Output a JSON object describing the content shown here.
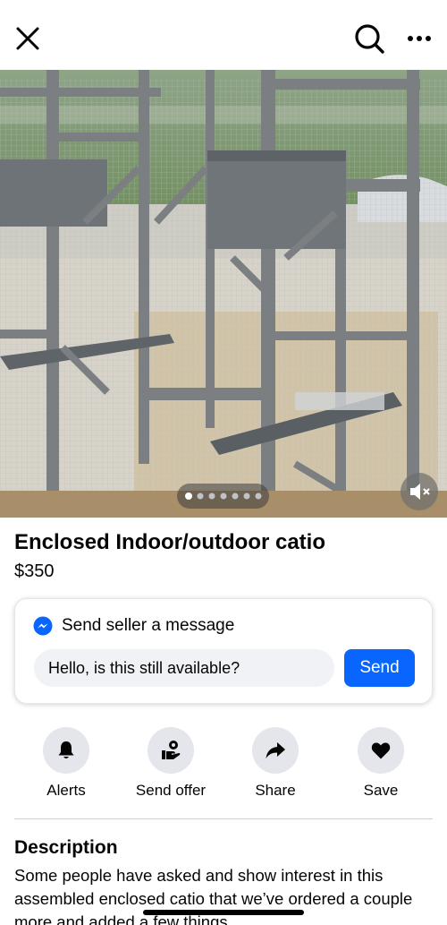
{
  "header": {
    "close_icon": "close-icon",
    "search_icon": "search-icon",
    "more_icon": "more-icon"
  },
  "photo": {
    "page_count": 7,
    "current_page": 1,
    "mute_icon": "speaker-muted-icon"
  },
  "listing": {
    "title": "Enclosed Indoor/outdoor catio",
    "price": "$350"
  },
  "message_card": {
    "title": "Send seller a message",
    "input_value": "Hello, is this still available?",
    "send_label": "Send",
    "accent": "#0866ff"
  },
  "actions": [
    {
      "label": "Alerts",
      "icon": "bell-icon"
    },
    {
      "label": "Send offer",
      "icon": "offer-icon"
    },
    {
      "label": "Share",
      "icon": "share-arrow-icon"
    },
    {
      "label": "Save",
      "icon": "heart-icon"
    }
  ],
  "description": {
    "heading": "Description",
    "body": "Some people have asked and show interest in this assembled enclosed catio that we’ve ordered a couple more and added a few things."
  }
}
